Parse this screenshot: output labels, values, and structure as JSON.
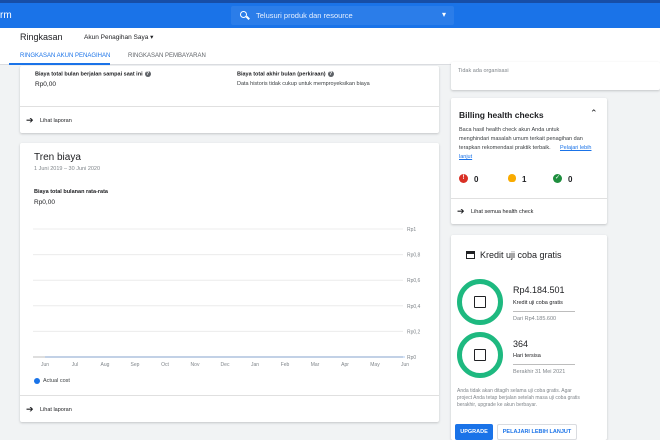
{
  "topbar": {
    "brand_fragment": "rm",
    "search_placeholder": "Telusuri produk dan resource",
    "search_dropdown": "▾"
  },
  "header": {
    "title": "Ringkasan",
    "account": "Akun Penagihan Saya ▾"
  },
  "tabs": [
    {
      "label": "RINGKASAN AKUN PENAGIHAN",
      "active": true
    },
    {
      "label": "RINGKASAN PEMBAYARAN",
      "active": false
    }
  ],
  "summary_card": {
    "month_cost_label": "Biaya total bulan berjalan sampai saat ini",
    "month_cost_value": "Rp0,00",
    "eom_label": "Biaya total akhir bulan (perkiraan)",
    "eom_text": "Data historis tidak cukup untuk memproyeksikan biaya",
    "report_link": "Lihat laporan"
  },
  "trend_card": {
    "title": "Tren biaya",
    "range": "1 Juni 2019 – 30 Juni 2020",
    "avg_label": "Biaya total bulanan rata-rata",
    "avg_value": "Rp0,00",
    "legend": "Actual cost",
    "report_link": "Lihat laporan"
  },
  "chart_data": {
    "type": "line",
    "categories": [
      "Jun",
      "Jul",
      "Aug",
      "Sep",
      "Oct",
      "Nov",
      "Dec",
      "Jan",
      "Feb",
      "Mar",
      "Apr",
      "May",
      "Jun"
    ],
    "series": [
      {
        "name": "Actual cost",
        "values": [
          0,
          0,
          0,
          0,
          0,
          0,
          0,
          0,
          0,
          0,
          0,
          0,
          0
        ]
      }
    ],
    "y_ticks": [
      "Rp1",
      "Rp0,8",
      "Rp0,6",
      "Rp0,4",
      "Rp0,2",
      "Rp0"
    ],
    "ylim": [
      0,
      1
    ],
    "grid": true,
    "series_color": "#1a73e8"
  },
  "org_card": {
    "text": "Tidak ada organisasi"
  },
  "health_card": {
    "title": "Billing health checks",
    "desc_1": "Baca hasil health check akun Anda untuk",
    "desc_2": "menghindari masalah umum terkait penagihan dan",
    "desc_3": "terapkan rekomendasi praktik terbaik.",
    "learn_1": "Pelajari lebih",
    "learn_2": "lanjut",
    "errors": "0",
    "warnings": "1",
    "passed": "0",
    "view_link": "Lihat semua health check",
    "colors": {
      "error": "#d93025",
      "warning": "#f9ab00",
      "ok": "#1e8e3e"
    }
  },
  "credit_card": {
    "title": "Kredit uji coba gratis",
    "credit_value": "Rp4.184.501",
    "credit_label": "Kredit uji coba gratis",
    "credit_total": "Dari Rp4.185.600",
    "days_value": "364",
    "days_label": "Hari tersisa",
    "days_end": "Berakhir 31 Mei 2021",
    "note_1": "Anda tidak akan ditagih selama uji coba gratis. Agar",
    "note_2": "project Anda tetap berjalan setelah masa uji coba gratis",
    "note_3": "berakhir, upgrade ke akun berbayar.",
    "upgrade_button": "UPGRADE",
    "learn_button": "PELAJARI LEBIH LANJUT",
    "ring_color": "#1eb980"
  }
}
